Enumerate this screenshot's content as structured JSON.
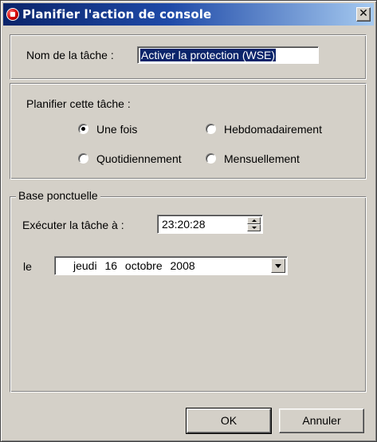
{
  "window": {
    "title": "Planifier l'action de console",
    "close_label": "✕"
  },
  "task": {
    "name_label": "Nom de la tâche :",
    "name_value": "Activer la protection (WSE)"
  },
  "schedule": {
    "label": "Planifier cette tâche :",
    "options": [
      {
        "label": "Une fois",
        "checked": true
      },
      {
        "label": "Hebdomadairement",
        "checked": false
      },
      {
        "label": "Quotidiennement",
        "checked": false
      },
      {
        "label": "Mensuellement",
        "checked": false
      }
    ]
  },
  "once": {
    "group_title": "Base ponctuelle",
    "run_label": "Exécuter la tâche à :",
    "time_value": "23:20:28",
    "date_label": "le",
    "date_value": "jeudi 16 octobre 2008"
  },
  "buttons": {
    "ok": "OK",
    "cancel": "Annuler"
  }
}
